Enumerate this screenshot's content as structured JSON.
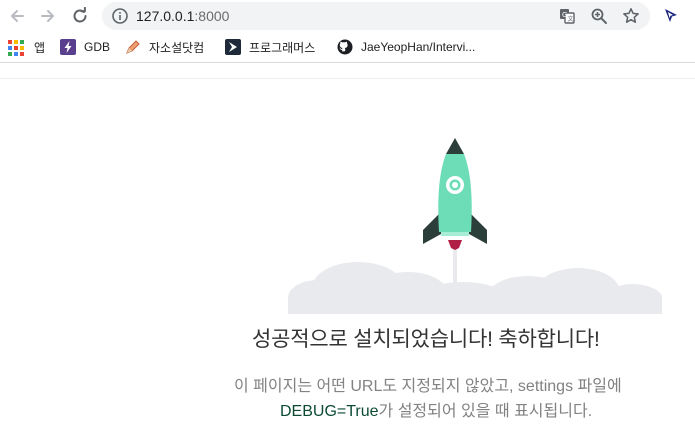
{
  "browser": {
    "url_host": "127.0.0.1",
    "url_port": ":8000",
    "bookmarks": [
      {
        "label": "앱",
        "icon": "apps-grid-icon"
      },
      {
        "label": "GDB",
        "icon": "gdb-bolt-icon"
      },
      {
        "label": "자소설닷컴",
        "icon": "pencil-icon"
      },
      {
        "label": "프로그래머스",
        "icon": "programmers-icon"
      },
      {
        "label": "JaeYeopHan/Intervi...",
        "icon": "github-icon"
      }
    ]
  },
  "page": {
    "title": "성공적으로 설치되었습니다! 축하합니다!",
    "description_line1": "이 페이지는 어떤 URL도 지정되지 않았고, settings 파일에",
    "description_code": "DEBUG=True",
    "description_line2_rest": "가 설정되어 있을 때 표시됩니다."
  },
  "colors": {
    "rocket_body": "#6dddb8",
    "rocket_fins": "#2c3e3a",
    "rocket_flame": "#b01e45",
    "clouds": "#e8eaed",
    "code_text": "#0c4b33"
  }
}
